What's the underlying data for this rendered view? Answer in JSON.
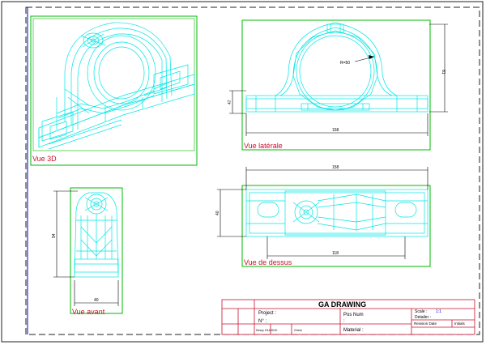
{
  "views": {
    "iso_label": "Vue 3D",
    "side_label": "Vue latérale",
    "front_label": "Vue avant",
    "top_label": "Vue de dessus"
  },
  "dimensions": {
    "side_radius": "R=50",
    "side_width": "158",
    "side_height": "81",
    "side_base": "47",
    "top_width": "158",
    "top_inner": "118",
    "top_depth": "40",
    "front_height": "94",
    "front_width": "40"
  },
  "title_block": {
    "title": "GA DRAWING",
    "project_label": "Project :",
    "number_label": "N° :",
    "pos_label": "Pos Num",
    "pos_value": ":",
    "material_label": "Material :",
    "scale_label": "Scale :",
    "scale_value": "1:1",
    "detailer_label": "Detailer :",
    "revision_label": "Revision Date",
    "initials_label": "Initials",
    "date_value": "Dessy 2/14/2010",
    "check_label": "Check"
  },
  "colors": {
    "geometry": "#00e5e5",
    "frame": "#00b800",
    "dimension": "#000000",
    "label": "#c8102e",
    "sheet_border": "#0000d0",
    "title_block": "#c8102e"
  }
}
